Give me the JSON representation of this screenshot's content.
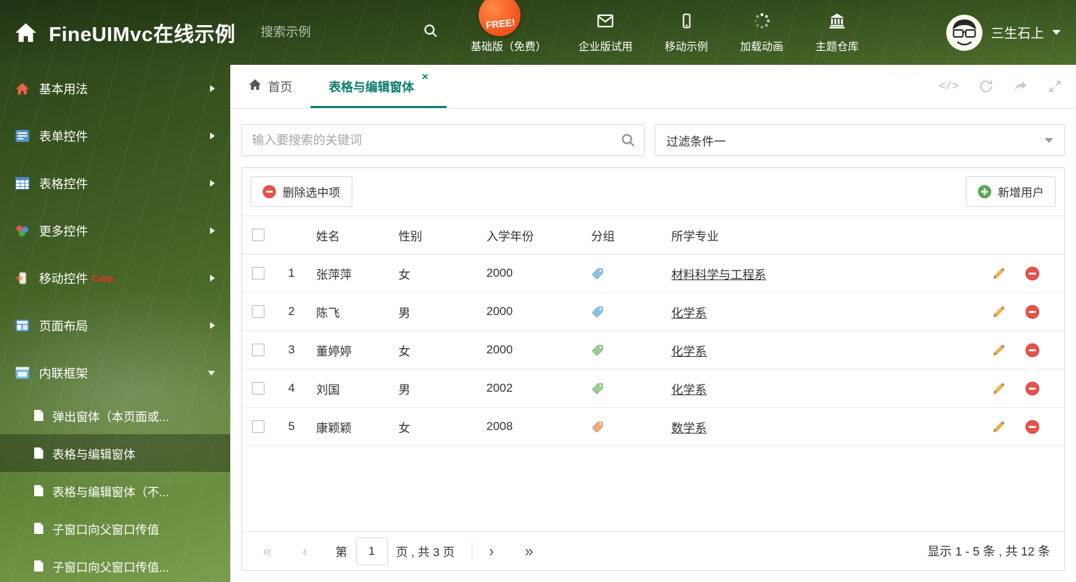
{
  "colors": {
    "accent": "#0e7d6f",
    "delete_red": "#e3544b",
    "add_green": "#58aa4f",
    "edit_orange": "#edb54d",
    "corp_badge": "#ff2d2d",
    "free_badge": "#f1511b"
  },
  "header": {
    "title": "FineUIMvc在线示例",
    "search_placeholder": "搜索示例",
    "free_badge": "FREE!",
    "nav": [
      {
        "label": "基础版（免费）"
      },
      {
        "label": "企业版试用"
      },
      {
        "label": "移动示例"
      },
      {
        "label": "加载动画"
      },
      {
        "label": "主题仓库"
      }
    ],
    "user_name": "三生石上"
  },
  "sidebar": {
    "items": [
      {
        "label": "基本用法"
      },
      {
        "label": "表单控件"
      },
      {
        "label": "表格控件"
      },
      {
        "label": "更多控件"
      },
      {
        "label": "移动控件",
        "badge": "Corp."
      },
      {
        "label": "页面布局"
      },
      {
        "label": "内联框架"
      }
    ],
    "subitems": [
      {
        "label": "弹出窗体（本页面或..."
      },
      {
        "label": "表格与编辑窗体"
      },
      {
        "label": "表格与编辑窗体（不..."
      },
      {
        "label": "子窗口向父窗口传值"
      },
      {
        "label": "子窗口向父窗口传值..."
      }
    ]
  },
  "tabs": {
    "home": "首页",
    "active": "表格与编辑窗体"
  },
  "filter": {
    "search_placeholder": "输入要搜索的关键词",
    "selected": "过滤条件一"
  },
  "grid": {
    "delete_button": "删除选中项",
    "add_button": "新增用户",
    "columns": [
      "姓名",
      "性别",
      "入学年份",
      "分组",
      "所学专业"
    ],
    "rows": [
      {
        "num": "1",
        "name": "张萍萍",
        "gender": "女",
        "year": "2000",
        "tag_color": "#85c4e8",
        "major": "材料科学与工程系"
      },
      {
        "num": "2",
        "name": "陈飞",
        "gender": "男",
        "year": "2000",
        "tag_color": "#85c4e8",
        "major": "化学系"
      },
      {
        "num": "3",
        "name": "董婷婷",
        "gender": "女",
        "year": "2000",
        "tag_color": "#97cf8c",
        "major": "化学系"
      },
      {
        "num": "4",
        "name": "刘国",
        "gender": "男",
        "year": "2002",
        "tag_color": "#97cf8c",
        "major": "化学系"
      },
      {
        "num": "5",
        "name": "康颖颖",
        "gender": "女",
        "year": "2008",
        "tag_color": "#f3ab70",
        "major": "数学系"
      }
    ]
  },
  "pagination": {
    "prefix": "第",
    "current_page": "1",
    "suffix": "页 , 共 3 页",
    "summary": "显示 1 - 5 条 , 共 12 条"
  }
}
